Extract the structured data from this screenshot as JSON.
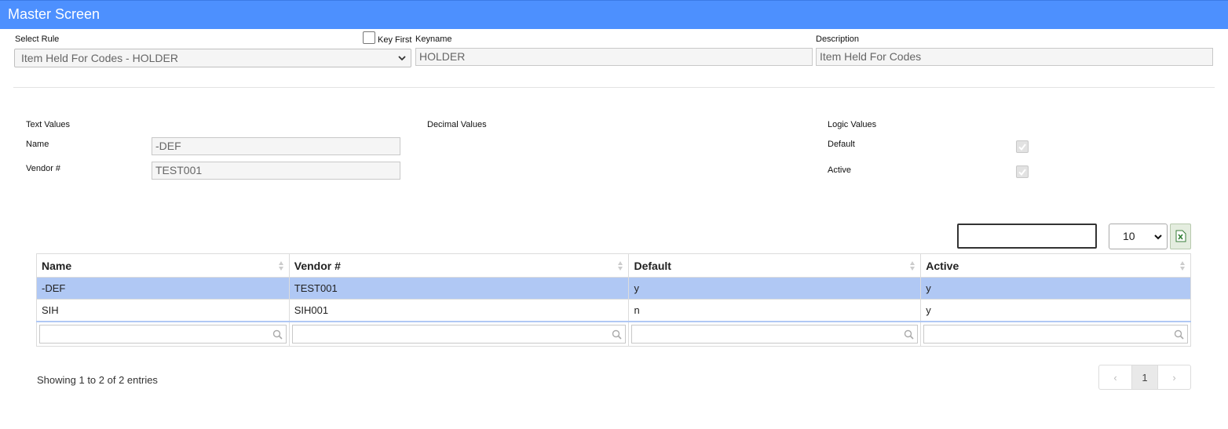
{
  "header": {
    "title": "Master Screen"
  },
  "rule": {
    "select_label": "Select Rule",
    "selected": "Item Held For Codes - HOLDER",
    "key_first_label": "Key First",
    "keyname_label": "Keyname",
    "keyname_value": "HOLDER",
    "description_label": "Description",
    "description_value": "Item Held For Codes"
  },
  "sections": {
    "text_values": "Text Values",
    "decimal_values": "Decimal Values",
    "logic_values": "Logic Values"
  },
  "text_fields": {
    "name_label": "Name",
    "name_value": "-DEF",
    "vendor_label": "Vendor #",
    "vendor_value": "TEST001"
  },
  "logic_fields": {
    "default_label": "Default",
    "default_checked": true,
    "active_label": "Active",
    "active_checked": true
  },
  "grid": {
    "page_length": "10",
    "columns": [
      "Name",
      "Vendor #",
      "Default",
      "Active"
    ],
    "rows": [
      [
        "-DEF",
        "TEST001",
        "y",
        "y"
      ],
      [
        "SIH",
        "SIH001",
        "n",
        "y"
      ]
    ],
    "selected_row": 0,
    "info": "Showing 1 to 2 of 2 entries",
    "pagination": {
      "prev": "‹",
      "current": "1",
      "next": "›"
    }
  },
  "colors": {
    "header_bg": "#4d90fe",
    "selected_row": "#b0c8f4"
  }
}
